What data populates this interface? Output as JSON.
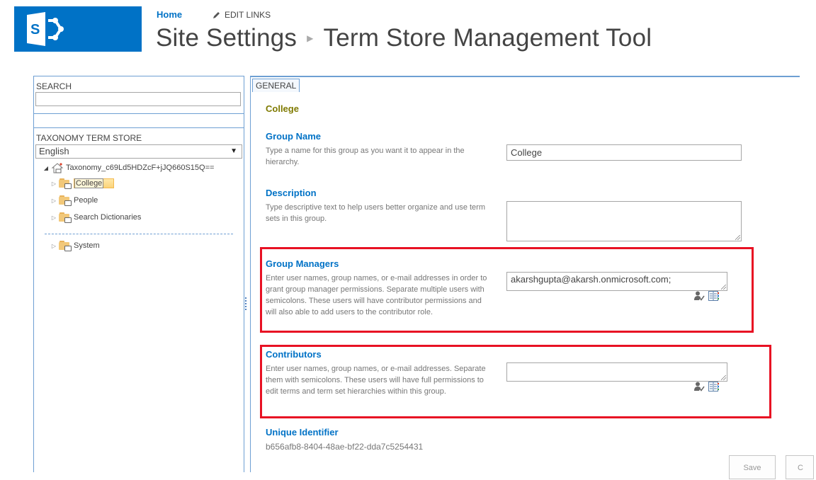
{
  "header": {
    "logo_icon": "sharepoint-logo-icon",
    "nav_home": "Home",
    "edit_links": "EDIT LINKS",
    "edit_icon": "pencil-icon",
    "breadcrumb": [
      "Site Settings",
      "Term Store Management Tool"
    ],
    "breadcrumb_separator_icon": "triangle-right-icon"
  },
  "left_panel": {
    "search_label": "SEARCH",
    "search_value": "",
    "taxonomy_label": "TAXONOMY TERM STORE",
    "language_selected": "English",
    "tree": {
      "root": "Taxonomy_c69Ld5HDZcF+jJQ660S15Q==",
      "groups": [
        {
          "label": "College",
          "selected": true
        },
        {
          "label": "People",
          "selected": false
        },
        {
          "label": "Search Dictionaries",
          "selected": false
        }
      ],
      "system_groups": [
        {
          "label": "System",
          "selected": false
        }
      ]
    }
  },
  "right_panel": {
    "tab": "GENERAL",
    "group_title": "College",
    "group_name": {
      "title": "Group Name",
      "description": "Type a name for this group as you want it to appear in the hierarchy.",
      "value": "College"
    },
    "description_field": {
      "title": "Description",
      "description": "Type descriptive text to help users better organize and use term sets in this group.",
      "value": ""
    },
    "group_managers": {
      "title": "Group Managers",
      "description": "Enter user names, group names, or e-mail addresses in order to grant group manager permissions. Separate multiple users with semicolons. These users will have contributor permissions and will also able to add users to the contributor role.",
      "value": "akarshgupta@akarsh.onmicrosoft.com;"
    },
    "contributors": {
      "title": "Contributors",
      "description": "Enter user names, group names, or e-mail addresses. Separate them with semicolons. These users will have full permissions to edit terms and term set hierarchies within this group.",
      "value": ""
    },
    "unique_identifier": {
      "title": "Unique Identifier",
      "value": "b656afb8-8404-48ae-bf22-dda7c5254431"
    },
    "buttons": {
      "save": "Save",
      "cancel": "C"
    }
  },
  "colors": {
    "brand_blue": "#0072c6",
    "panel_border": "#6e9fd3",
    "highlight_red": "#e81123",
    "group_title_olive": "#7f7a00"
  }
}
